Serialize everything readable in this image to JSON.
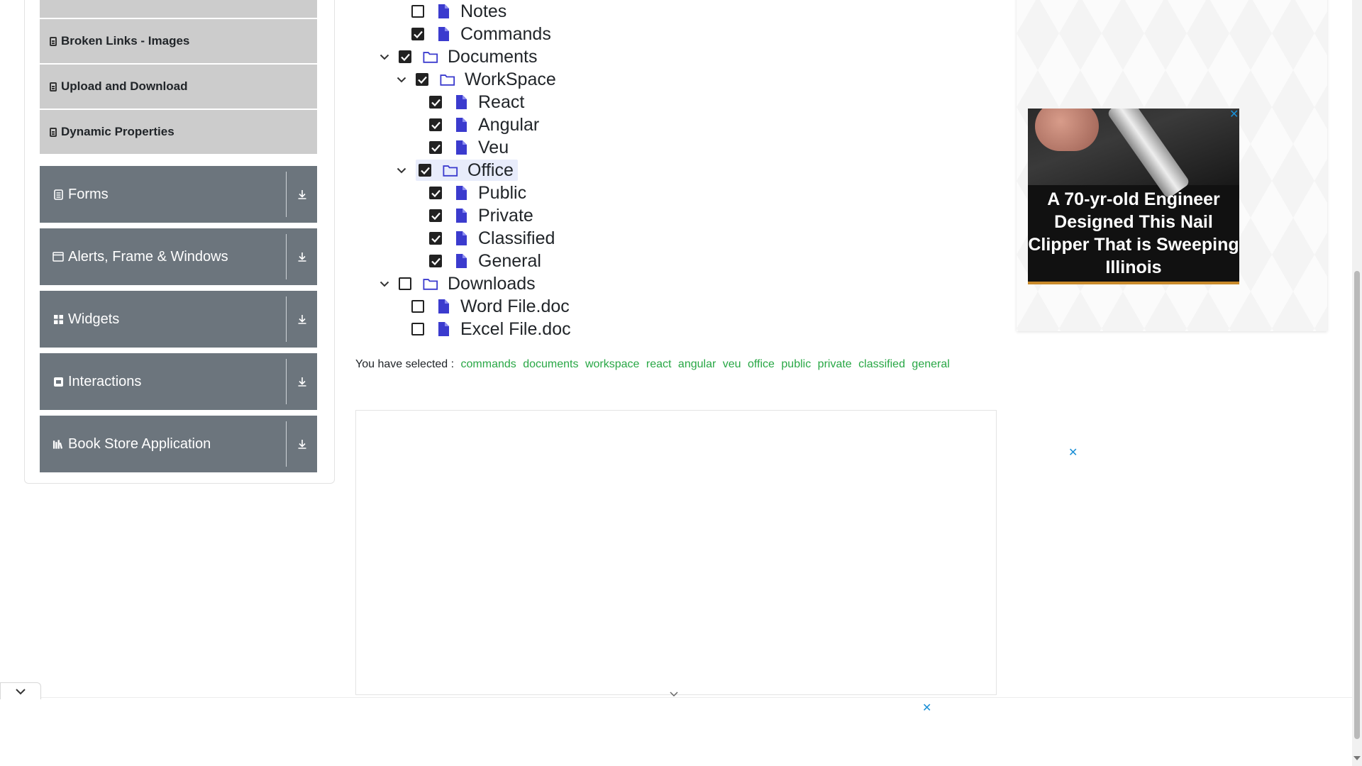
{
  "sidebar": {
    "sub_items": [
      {
        "label": ""
      },
      {
        "label": "Broken Links - Images"
      },
      {
        "label": "Upload and Download"
      },
      {
        "label": "Dynamic Properties"
      }
    ],
    "groups": [
      {
        "label": "Forms",
        "icon": "form-icon"
      },
      {
        "label": "Alerts, Frame & Windows",
        "icon": "window-icon"
      },
      {
        "label": "Widgets",
        "icon": "widgets-icon"
      },
      {
        "label": "Interactions",
        "icon": "interactions-icon"
      },
      {
        "label": "Book Store Application",
        "icon": "books-icon"
      }
    ]
  },
  "tree": {
    "nodes": [
      {
        "label": "Notes",
        "type": "file",
        "checked": false
      },
      {
        "label": "Commands",
        "type": "file",
        "checked": true
      },
      {
        "label": "Documents",
        "type": "folder",
        "checked": true,
        "expanded": true
      },
      {
        "label": "WorkSpace",
        "type": "folder",
        "checked": true,
        "expanded": true
      },
      {
        "label": "React",
        "type": "file",
        "checked": true
      },
      {
        "label": "Angular",
        "type": "file",
        "checked": true
      },
      {
        "label": "Veu",
        "type": "file",
        "checked": true
      },
      {
        "label": "Office",
        "type": "folder",
        "checked": true,
        "expanded": true,
        "highlighted": true
      },
      {
        "label": "Public",
        "type": "file",
        "checked": true
      },
      {
        "label": "Private",
        "type": "file",
        "checked": true
      },
      {
        "label": "Classified",
        "type": "file",
        "checked": true
      },
      {
        "label": "General",
        "type": "file",
        "checked": true
      },
      {
        "label": "Downloads",
        "type": "folder",
        "checked": false,
        "expanded": true
      },
      {
        "label": "Word File.doc",
        "type": "file",
        "checked": false
      },
      {
        "label": "Excel File.doc",
        "type": "file",
        "checked": false
      }
    ]
  },
  "selected": {
    "prefix": "You have selected :",
    "items": [
      "commands",
      "documents",
      "workspace",
      "react",
      "angular",
      "veu",
      "office",
      "public",
      "private",
      "classified",
      "general"
    ]
  },
  "ad": {
    "headline": "A 70-yr-old Engineer Designed This Nail Clipper That is Sweeping Illinois",
    "close_glyph": "✕"
  },
  "colors": {
    "sidebar_group_bg": "#6c757d",
    "sub_item_bg": "#cccccc",
    "file_icon": "#3b3bce",
    "selected_text": "#28a745",
    "ad_close": "#1a8fd6"
  }
}
